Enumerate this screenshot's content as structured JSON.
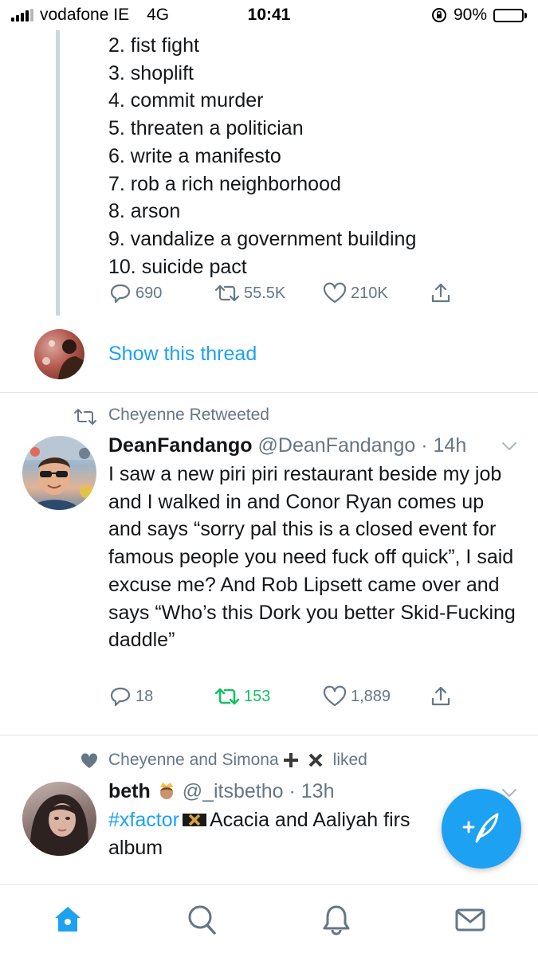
{
  "status_bar": {
    "carrier": "vodafone IE",
    "network": "4G",
    "time": "10:41",
    "battery": "90%",
    "battery_level": 0.9
  },
  "thread": {
    "list_items": [
      "2. fist fight",
      "3. shoplift",
      "4. commit murder",
      "5. threaten a politician",
      "6. write a manifesto",
      "7.  rob a rich neighborhood",
      "8. arson",
      "9. vandalize a government building",
      "10. suicide pact"
    ],
    "replies": "690",
    "retweets": "55.5K",
    "likes": "210K",
    "show_thread": "Show this thread"
  },
  "tweet2": {
    "context": "Cheyenne Retweeted",
    "name": "DeanFandango",
    "handle": "@DeanFandango",
    "time": "· 14h",
    "text": "I saw a new piri piri restaurant beside my job and I walked in and Conor Ryan comes up and says “sorry pal this is a closed event for famous people you need fuck off quick”, I said excuse me? And Rob Lipsett came over and says “Who’s this Dork you better Skid-Fucking daddle”",
    "replies": "18",
    "retweets": "153",
    "likes": "1,889"
  },
  "tweet3": {
    "context": "Cheyenne and Simona",
    "context_suffix": "liked",
    "name": "beth",
    "handle": "@_itsbetho",
    "time": "· 13h",
    "hashtag": "#xfactor",
    "text_rest": "Acacia and Aaliyah firs",
    "text_line2": "album"
  },
  "colors": {
    "accent": "#1da1f2",
    "retweet_active": "#17bf63",
    "secondary_text": "#657786",
    "divider": "#e1e8ed"
  },
  "icons": {
    "reply": "reply-icon",
    "retweet": "retweet-icon",
    "like": "heart-icon",
    "share": "share-icon",
    "compose": "compose-icon",
    "home": "home-icon",
    "search": "search-icon",
    "notifications": "bell-icon",
    "messages": "mail-icon"
  }
}
